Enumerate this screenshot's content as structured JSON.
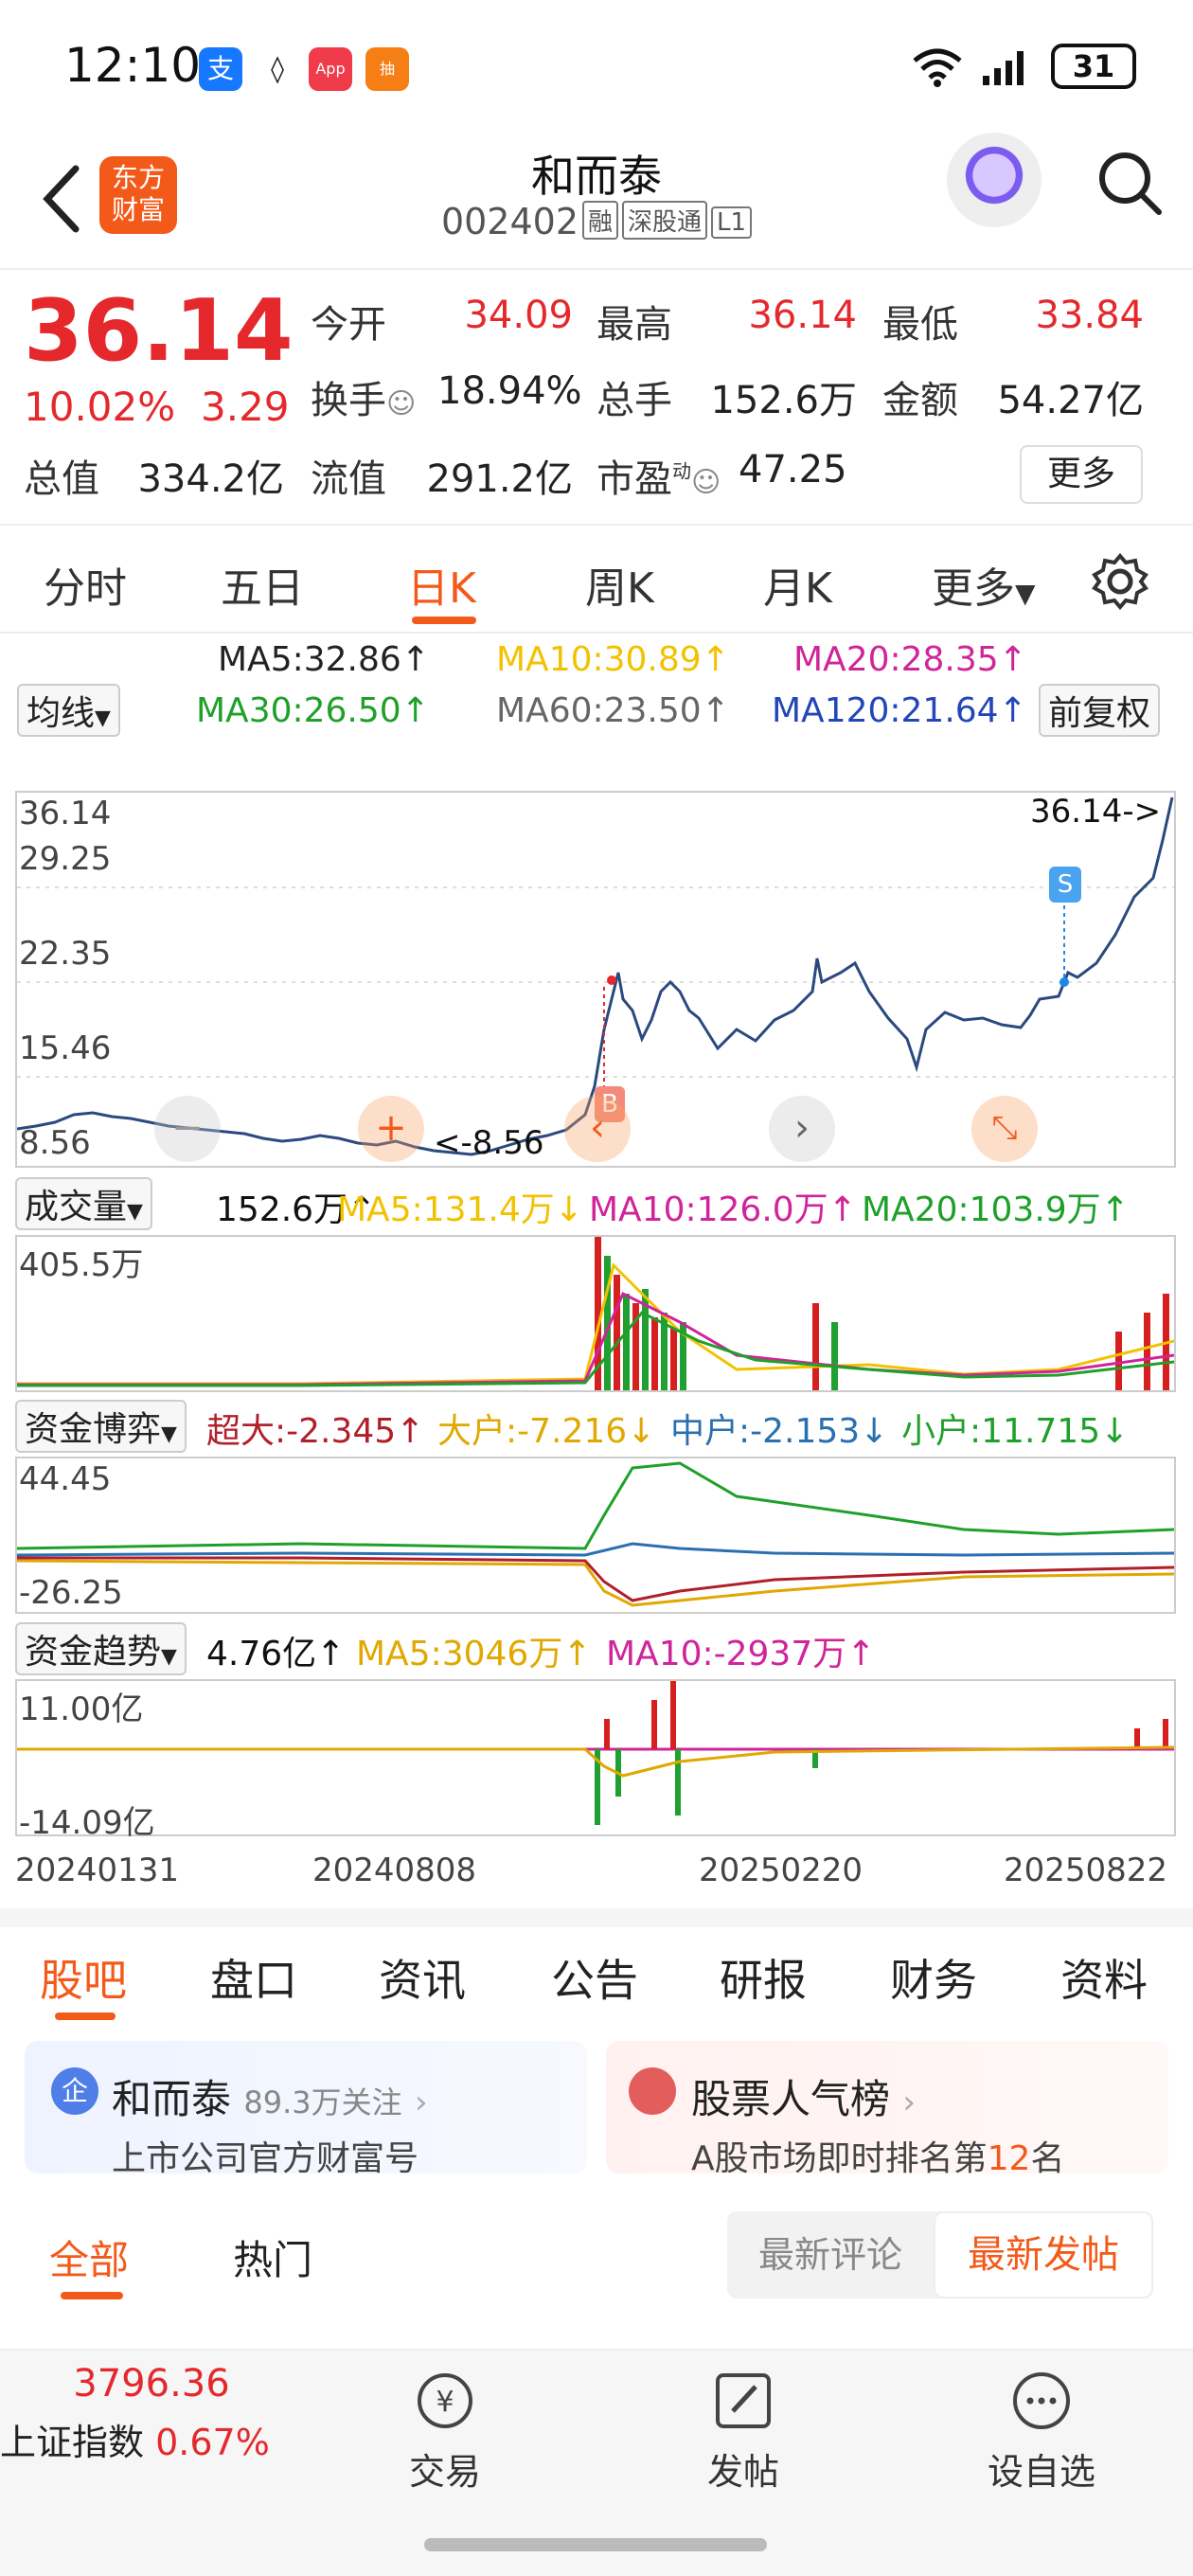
{
  "status_bar": {
    "time": "12:10",
    "battery": "31"
  },
  "header": {
    "logo_line1": "东方",
    "logo_line2": "财富",
    "stock_name": "和而泰",
    "stock_code": "002402",
    "tags": [
      "融",
      "深股通",
      "L1"
    ]
  },
  "quote": {
    "price": "36.14",
    "change_pct": "10.02%",
    "change_amt": "3.29",
    "open_label": "今开",
    "open": "34.09",
    "high_label": "最高",
    "high": "36.14",
    "low_label": "最低",
    "low": "33.84",
    "turnover_label": "换手",
    "turnover": "18.94%",
    "volume_label": "总手",
    "volume": "152.6万",
    "amount_label": "金额",
    "amount": "54.27亿",
    "mcap_label": "总值",
    "mcap": "334.2亿",
    "float_label": "流值",
    "float": "291.2亿",
    "pe_label": "市盈",
    "pe_sup": "动",
    "pe": "47.25",
    "more": "更多"
  },
  "period_tabs": [
    "分时",
    "五日",
    "日K",
    "周K",
    "月K",
    "更多"
  ],
  "kline": {
    "ma_select": "均线",
    "adj_button": "前复权",
    "ma5": "MA5:32.86↑",
    "ma10": "MA10:30.89↑",
    "ma20": "MA20:28.35↑",
    "ma30": "MA30:26.50↑",
    "ma60": "MA60:23.50↑",
    "ma120": "MA120:21.64↑",
    "y_labels": [
      "36.14",
      "29.25",
      "22.35",
      "15.46",
      "8.56"
    ],
    "max_label": "36.14->",
    "min_label": "<-8.56",
    "buy_marker": "B",
    "sell_marker": "S",
    "colors": {
      "ma5": "#222222",
      "ma10": "#f2c200",
      "ma20": "#d0249a",
      "ma30": "#1fa02a",
      "ma60": "#666666",
      "ma120": "#2346b8",
      "price_line": "#2a4a7f"
    }
  },
  "volume": {
    "select": "成交量",
    "val": "152.6万↑",
    "ma5": "MA5:131.4万↓",
    "ma10": "MA10:126.0万↑",
    "ma20": "MA20:103.9万↑",
    "top": "405.5万"
  },
  "fund_game": {
    "select": "资金博弈",
    "super": "超大:-2.345↑",
    "large": "大户:-7.216↓",
    "mid": "中户:-2.153↓",
    "small": "小户:11.715↓",
    "top": "44.45",
    "bottom": "-26.25"
  },
  "fund_trend": {
    "select": "资金趋势",
    "val": "4.76亿↑",
    "ma5": "MA5:3046万↑",
    "ma10": "MA10:-2937万↑",
    "top": "11.00亿",
    "bottom": "-14.09亿"
  },
  "x_dates": [
    "20240131",
    "20240808",
    "20250220",
    "20250822"
  ],
  "bottom_tabs": [
    "股吧",
    "盘口",
    "资讯",
    "公告",
    "研报",
    "财务",
    "资料"
  ],
  "cards": {
    "left_badge": "企",
    "left_title": "和而泰",
    "left_follow": "89.3万关注",
    "left_sub": "上市公司官方财富号",
    "right_title": "股票人气榜",
    "right_sub_pre": "A股市场即时排名第",
    "right_rank": "12",
    "right_sub_post": "名"
  },
  "feed_tabs": {
    "all": "全部",
    "hot": "热门",
    "latest_comment": "最新评论",
    "latest_post": "最新发帖"
  },
  "bottom_nav": {
    "index_value": "3796.36",
    "index_name": "上证指数",
    "index_pct": "0.67%",
    "trade": "交易",
    "post": "发帖",
    "watchlist": "设自选"
  }
}
